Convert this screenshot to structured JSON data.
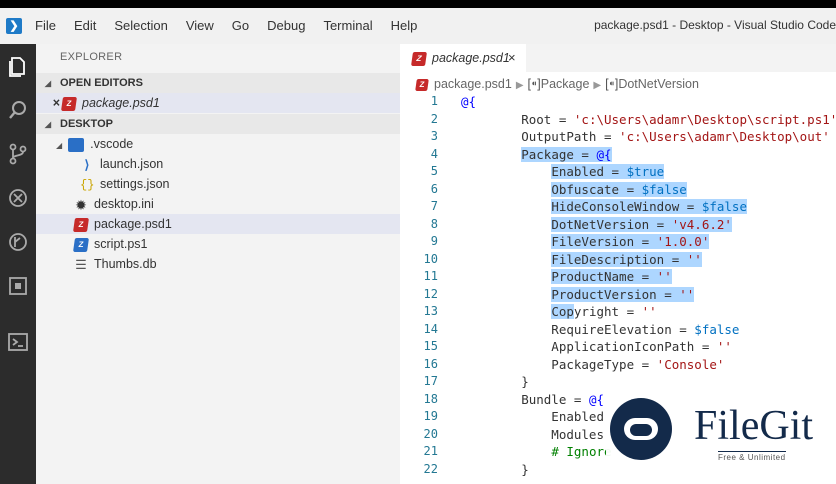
{
  "window": {
    "title": "package.psd1 - Desktop - Visual Studio Code",
    "menu": [
      "File",
      "Edit",
      "Selection",
      "View",
      "Go",
      "Debug",
      "Terminal",
      "Help"
    ]
  },
  "activitybar": [
    "files-icon",
    "search-icon",
    "source-control-icon",
    "debug-icon",
    "git-lens-icon",
    "extensions-icon",
    "terminal-icon"
  ],
  "sidebar": {
    "title": "EXPLORER",
    "open_editors_header": "OPEN EDITORS",
    "open_editors": [
      {
        "name": "package.psd1",
        "close": "×"
      }
    ],
    "folder_header": "DESKTOP",
    "tree": [
      {
        "name": ".vscode",
        "caret": "◢"
      },
      {
        "name": "launch.json"
      },
      {
        "name": "settings.json"
      },
      {
        "name": "desktop.ini"
      },
      {
        "name": "package.psd1"
      },
      {
        "name": "script.ps1"
      },
      {
        "name": "Thumbs.db"
      }
    ]
  },
  "editor": {
    "tab": {
      "label": "package.psd1",
      "close": "×"
    },
    "breadcrumb": [
      "package.psd1",
      "Package",
      "DotNetVersion"
    ],
    "lines": [
      {
        "n": "1",
        "text": "@{"
      },
      {
        "n": "2",
        "text": "        Root = 'c:\\Users\\adamr\\Desktop\\script.ps1'"
      },
      {
        "n": "3",
        "text": "        OutputPath = 'c:\\Users\\adamr\\Desktop\\out'"
      },
      {
        "n": "4",
        "text": "        Package = @{"
      },
      {
        "n": "5",
        "text": "            Enabled = $true"
      },
      {
        "n": "6",
        "text": "            Obfuscate = $false"
      },
      {
        "n": "7",
        "text": "            HideConsoleWindow = $false"
      },
      {
        "n": "8",
        "text": "            DotNetVersion = 'v4.6.2'"
      },
      {
        "n": "9",
        "text": "            FileVersion = '1.0.0'"
      },
      {
        "n": "10",
        "text": "            FileDescription = ''"
      },
      {
        "n": "11",
        "text": "            ProductName = ''"
      },
      {
        "n": "12",
        "text": "            ProductVersion = ''"
      },
      {
        "n": "13",
        "text": "            Copyright = ''"
      },
      {
        "n": "14",
        "text": "            RequireElevation = $false"
      },
      {
        "n": "15",
        "text": "            ApplicationIconPath = ''"
      },
      {
        "n": "16",
        "text": "            PackageType = 'Console'"
      },
      {
        "n": "17",
        "text": "        }"
      },
      {
        "n": "18",
        "text": "        Bundle = @{"
      },
      {
        "n": "19",
        "text": "            Enabled"
      },
      {
        "n": "20",
        "text": "            Modules"
      },
      {
        "n": "21",
        "text": "            # Ignore"
      },
      {
        "n": "22",
        "text": "        }"
      }
    ]
  },
  "watermark": {
    "name": "FileGit",
    "tagline": "Free & Unlimited"
  },
  "colors": {
    "selection": "#add6ff",
    "activitybar": "#2c2c2c",
    "sidebar": "#f3f3f3",
    "line_numbers": "#237893"
  }
}
